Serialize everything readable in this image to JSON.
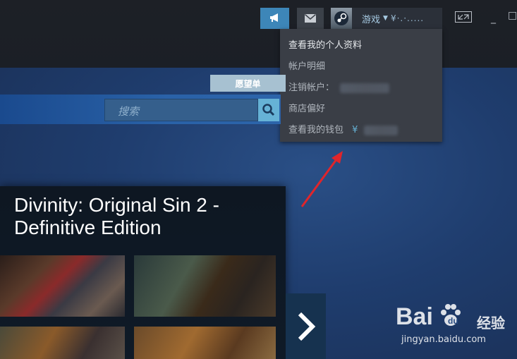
{
  "toolbar": {
    "announce_icon": "megaphone-icon",
    "mail_icon": "envelope-icon",
    "account_name": "游戏",
    "account_balance": "¥·.·.....",
    "fullscreen_icon": "expand-icon",
    "minimize_glyph": "_",
    "maximize_glyph": "□"
  },
  "account_menu": {
    "items": [
      "查看我的个人资料",
      "帐户明细",
      "注销帐户：",
      "商店偏好",
      "查看我的钱包"
    ],
    "wallet_currency": "¥"
  },
  "store": {
    "wishlist_label": "愿望单",
    "search_placeholder": "搜索"
  },
  "featured": {
    "title": "Divinity: Original Sin 2 - Definitive Edition",
    "next_icon": "chevron-right-icon"
  },
  "watermark": {
    "brand": "Bai",
    "brand_suffix": "经验",
    "url": "jingyan.baidu.com"
  },
  "colors": {
    "accent": "#66b2d6",
    "annotation_arrow": "#e0252b"
  }
}
